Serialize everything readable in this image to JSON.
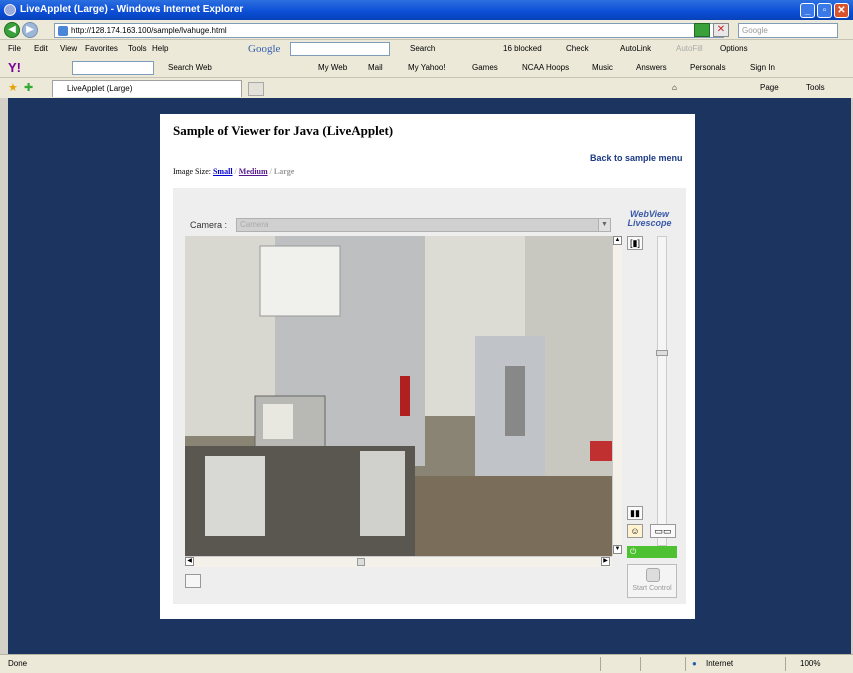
{
  "window": {
    "title": "LiveApplet (Large) - Windows Internet Explorer"
  },
  "address": {
    "url": "http://128.174.163.100/sample/lvahuge.html",
    "search_placeholder": "Google"
  },
  "menu": [
    "File",
    "Edit",
    "View",
    "Favorites",
    "Tools",
    "Help"
  ],
  "google_toolbar": {
    "logo": "Google",
    "search": "Search",
    "blocked": "16 blocked",
    "check": "Check",
    "autolink": "AutoLink",
    "autofill": "AutoFill",
    "options": "Options"
  },
  "yahoo_toolbar": {
    "search_web": "Search Web",
    "my_web": "My Web",
    "mail": "Mail",
    "my_yahoo": "My Yahoo!",
    "games": "Games",
    "ncaa": "NCAA Hoops",
    "music": "Music",
    "answers": "Answers",
    "personals": "Personals",
    "sign_in": "Sign In"
  },
  "tab": {
    "label": "LiveApplet (Large)"
  },
  "command_bar": {
    "page": "Page",
    "tools": "Tools"
  },
  "page": {
    "title": "Sample of Viewer for Java (LiveApplet)",
    "back_link": "Back to sample menu",
    "image_size_label": "Image Size:",
    "size_small": "Small",
    "size_medium": "Medium",
    "size_large": "Large"
  },
  "applet": {
    "camera_label": "Camera :",
    "camera_value": "Camera",
    "logo_line1": "WebView",
    "logo_line2": "Livescope",
    "start_control": "Start Control"
  },
  "status": {
    "left": "Done",
    "zone": "Internet",
    "zoom": "100%"
  }
}
